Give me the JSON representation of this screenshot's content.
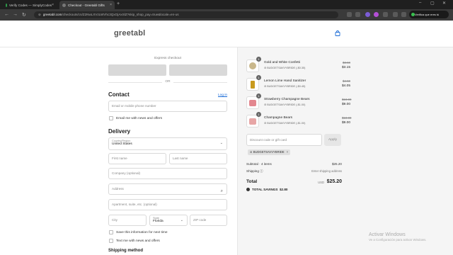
{
  "browser": {
    "tabs": [
      {
        "title": "Verify Codes — SimplyCodes",
        "active": false
      },
      {
        "title": "Checkout - Greetabl Gifts",
        "active": true
      }
    ],
    "url_host": "greetabl.com",
    "url_path": "/checkouts/cn/Z2NwLXVzLWVhc3QxOjAxSlZ?skip_shop_pay=true&locale=en-us",
    "verify_label": "Verifica que eres tú"
  },
  "header": {
    "logo": "greetabl"
  },
  "express": {
    "label": "Express checkout",
    "or": "OR"
  },
  "contact": {
    "title": "Contact",
    "login": "Log in",
    "phone_placeholder": "Email or mobile phone number",
    "news_label": "Email me with news and offers"
  },
  "delivery": {
    "title": "Delivery",
    "country_label": "Country/Region",
    "country_value": "United States",
    "first_name": "First name",
    "last_name": "Last name",
    "company": "Company (optional)",
    "address": "Address",
    "apartment": "Apartment, suite, etc. (optional)",
    "city": "City",
    "state_label": "State",
    "state_value": "Florida",
    "zip": "ZIP code",
    "save_info": "Save this information for next time",
    "text_me": "Text me with news and offers"
  },
  "shipping_method_title": "Shipping method",
  "order": {
    "items": [
      {
        "qty": "1",
        "name": "Gold and White Confetti",
        "discount": "BUDGETSAVVYBRIDE (-$0.35)",
        "original": "$3.50",
        "price": "$3.15",
        "thumb_color": "#c9b78b"
      },
      {
        "qty": "1",
        "name": "Lemon Lime Hand Sanitizer",
        "discount": "BUDGETSAVVYBRIDE (-$0.45)",
        "original": "$4.50",
        "price": "$4.05",
        "thumb_color": "#c89a1e"
      },
      {
        "qty": "1",
        "name": "Strawberry Champagne Bears",
        "discount": "BUDGETSAVVYBRIDE (-$1.00)",
        "original": "$10.00",
        "price": "$9.00",
        "thumb_color": "#e3878f"
      },
      {
        "qty": "1",
        "name": "Champagne Bears",
        "discount": "BUDGETSAVVYBRIDE (-$1.00)",
        "original": "$10.00",
        "price": "$9.00",
        "thumb_color": "#e7a6a6"
      }
    ],
    "discount_placeholder": "Discount code or gift card",
    "apply": "Apply",
    "applied_code": "BUDGETSAVVYBRIDE",
    "subtotal_label": "Subtotal · 4 items",
    "subtotal_value": "$25.20",
    "shipping_label": "Shipping",
    "shipping_value": "Enter shipping address",
    "total_label": "Total",
    "total_currency": "USD",
    "total_value": "$25.20",
    "savings_label": "TOTAL SAVINGS",
    "savings_value": "$2.80"
  },
  "watermark": {
    "line1": "Activar Windows",
    "line2": "Ve a Configuración para activar Windows."
  }
}
